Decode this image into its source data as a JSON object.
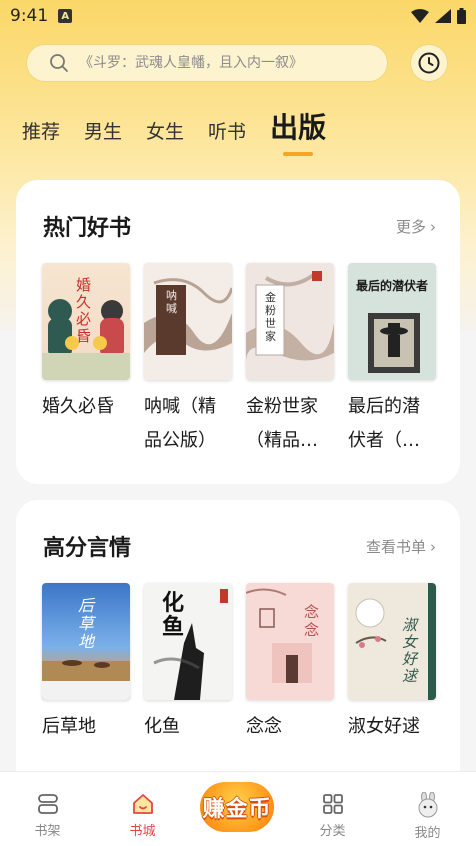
{
  "status_bar": {
    "time": "9:41",
    "app_badge": "A"
  },
  "search": {
    "placeholder": "《斗罗：武魂人皇幡，且入内一叙》"
  },
  "tabs": [
    {
      "label": "推荐"
    },
    {
      "label": "男生"
    },
    {
      "label": "女生"
    },
    {
      "label": "听书"
    },
    {
      "label": "出版",
      "active": true
    }
  ],
  "hot_section": {
    "title": "热门好书",
    "more_label": "更多",
    "books": [
      {
        "title": "婚久必昏",
        "cover_text": "婚久必昏"
      },
      {
        "title": "呐喊（精品公版）",
        "cover_text": "呐喊"
      },
      {
        "title": "金粉世家（精品…",
        "cover_text": "金粉世家"
      },
      {
        "title": "最后的潜伏者（…",
        "cover_text": "最后的潜伏者"
      }
    ]
  },
  "romance_section": {
    "title": "高分言情",
    "more_label": "查看书单",
    "books": [
      {
        "title": "后草地",
        "cover_text": "后草地"
      },
      {
        "title": "化鱼",
        "cover_text": "化鱼"
      },
      {
        "title": "念念",
        "cover_text": "念念"
      },
      {
        "title": "淑女好逑",
        "cover_text": "淑女好逑"
      }
    ]
  },
  "bottom_nav": {
    "items": [
      {
        "label": "书架",
        "icon": "bookshelf-icon"
      },
      {
        "label": "书城",
        "icon": "home-icon",
        "active": true
      },
      {
        "label": "赚金币",
        "icon": "coin-icon"
      },
      {
        "label": "分类",
        "icon": "grid-icon"
      },
      {
        "label": "我的",
        "icon": "avatar-icon"
      }
    ]
  },
  "colors": {
    "accent": "#f5a623",
    "active_nav": "#e94444",
    "header_bg": "#fbd768"
  }
}
